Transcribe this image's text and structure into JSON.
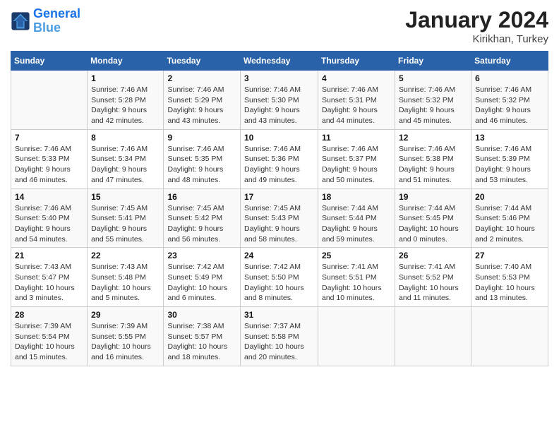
{
  "header": {
    "logo_line1": "General",
    "logo_line2": "Blue",
    "month": "January 2024",
    "location": "Kirikhan, Turkey"
  },
  "weekdays": [
    "Sunday",
    "Monday",
    "Tuesday",
    "Wednesday",
    "Thursday",
    "Friday",
    "Saturday"
  ],
  "weeks": [
    [
      {
        "day": "",
        "sunrise": "",
        "sunset": "",
        "daylight": ""
      },
      {
        "day": "1",
        "sunrise": "Sunrise: 7:46 AM",
        "sunset": "Sunset: 5:28 PM",
        "daylight": "Daylight: 9 hours and 42 minutes."
      },
      {
        "day": "2",
        "sunrise": "Sunrise: 7:46 AM",
        "sunset": "Sunset: 5:29 PM",
        "daylight": "Daylight: 9 hours and 43 minutes."
      },
      {
        "day": "3",
        "sunrise": "Sunrise: 7:46 AM",
        "sunset": "Sunset: 5:30 PM",
        "daylight": "Daylight: 9 hours and 43 minutes."
      },
      {
        "day": "4",
        "sunrise": "Sunrise: 7:46 AM",
        "sunset": "Sunset: 5:31 PM",
        "daylight": "Daylight: 9 hours and 44 minutes."
      },
      {
        "day": "5",
        "sunrise": "Sunrise: 7:46 AM",
        "sunset": "Sunset: 5:32 PM",
        "daylight": "Daylight: 9 hours and 45 minutes."
      },
      {
        "day": "6",
        "sunrise": "Sunrise: 7:46 AM",
        "sunset": "Sunset: 5:32 PM",
        "daylight": "Daylight: 9 hours and 46 minutes."
      }
    ],
    [
      {
        "day": "7",
        "sunrise": "Sunrise: 7:46 AM",
        "sunset": "Sunset: 5:33 PM",
        "daylight": "Daylight: 9 hours and 46 minutes."
      },
      {
        "day": "8",
        "sunrise": "Sunrise: 7:46 AM",
        "sunset": "Sunset: 5:34 PM",
        "daylight": "Daylight: 9 hours and 47 minutes."
      },
      {
        "day": "9",
        "sunrise": "Sunrise: 7:46 AM",
        "sunset": "Sunset: 5:35 PM",
        "daylight": "Daylight: 9 hours and 48 minutes."
      },
      {
        "day": "10",
        "sunrise": "Sunrise: 7:46 AM",
        "sunset": "Sunset: 5:36 PM",
        "daylight": "Daylight: 9 hours and 49 minutes."
      },
      {
        "day": "11",
        "sunrise": "Sunrise: 7:46 AM",
        "sunset": "Sunset: 5:37 PM",
        "daylight": "Daylight: 9 hours and 50 minutes."
      },
      {
        "day": "12",
        "sunrise": "Sunrise: 7:46 AM",
        "sunset": "Sunset: 5:38 PM",
        "daylight": "Daylight: 9 hours and 51 minutes."
      },
      {
        "day": "13",
        "sunrise": "Sunrise: 7:46 AM",
        "sunset": "Sunset: 5:39 PM",
        "daylight": "Daylight: 9 hours and 53 minutes."
      }
    ],
    [
      {
        "day": "14",
        "sunrise": "Sunrise: 7:46 AM",
        "sunset": "Sunset: 5:40 PM",
        "daylight": "Daylight: 9 hours and 54 minutes."
      },
      {
        "day": "15",
        "sunrise": "Sunrise: 7:45 AM",
        "sunset": "Sunset: 5:41 PM",
        "daylight": "Daylight: 9 hours and 55 minutes."
      },
      {
        "day": "16",
        "sunrise": "Sunrise: 7:45 AM",
        "sunset": "Sunset: 5:42 PM",
        "daylight": "Daylight: 9 hours and 56 minutes."
      },
      {
        "day": "17",
        "sunrise": "Sunrise: 7:45 AM",
        "sunset": "Sunset: 5:43 PM",
        "daylight": "Daylight: 9 hours and 58 minutes."
      },
      {
        "day": "18",
        "sunrise": "Sunrise: 7:44 AM",
        "sunset": "Sunset: 5:44 PM",
        "daylight": "Daylight: 9 hours and 59 minutes."
      },
      {
        "day": "19",
        "sunrise": "Sunrise: 7:44 AM",
        "sunset": "Sunset: 5:45 PM",
        "daylight": "Daylight: 10 hours and 0 minutes."
      },
      {
        "day": "20",
        "sunrise": "Sunrise: 7:44 AM",
        "sunset": "Sunset: 5:46 PM",
        "daylight": "Daylight: 10 hours and 2 minutes."
      }
    ],
    [
      {
        "day": "21",
        "sunrise": "Sunrise: 7:43 AM",
        "sunset": "Sunset: 5:47 PM",
        "daylight": "Daylight: 10 hours and 3 minutes."
      },
      {
        "day": "22",
        "sunrise": "Sunrise: 7:43 AM",
        "sunset": "Sunset: 5:48 PM",
        "daylight": "Daylight: 10 hours and 5 minutes."
      },
      {
        "day": "23",
        "sunrise": "Sunrise: 7:42 AM",
        "sunset": "Sunset: 5:49 PM",
        "daylight": "Daylight: 10 hours and 6 minutes."
      },
      {
        "day": "24",
        "sunrise": "Sunrise: 7:42 AM",
        "sunset": "Sunset: 5:50 PM",
        "daylight": "Daylight: 10 hours and 8 minutes."
      },
      {
        "day": "25",
        "sunrise": "Sunrise: 7:41 AM",
        "sunset": "Sunset: 5:51 PM",
        "daylight": "Daylight: 10 hours and 10 minutes."
      },
      {
        "day": "26",
        "sunrise": "Sunrise: 7:41 AM",
        "sunset": "Sunset: 5:52 PM",
        "daylight": "Daylight: 10 hours and 11 minutes."
      },
      {
        "day": "27",
        "sunrise": "Sunrise: 7:40 AM",
        "sunset": "Sunset: 5:53 PM",
        "daylight": "Daylight: 10 hours and 13 minutes."
      }
    ],
    [
      {
        "day": "28",
        "sunrise": "Sunrise: 7:39 AM",
        "sunset": "Sunset: 5:54 PM",
        "daylight": "Daylight: 10 hours and 15 minutes."
      },
      {
        "day": "29",
        "sunrise": "Sunrise: 7:39 AM",
        "sunset": "Sunset: 5:55 PM",
        "daylight": "Daylight: 10 hours and 16 minutes."
      },
      {
        "day": "30",
        "sunrise": "Sunrise: 7:38 AM",
        "sunset": "Sunset: 5:57 PM",
        "daylight": "Daylight: 10 hours and 18 minutes."
      },
      {
        "day": "31",
        "sunrise": "Sunrise: 7:37 AM",
        "sunset": "Sunset: 5:58 PM",
        "daylight": "Daylight: 10 hours and 20 minutes."
      },
      {
        "day": "",
        "sunrise": "",
        "sunset": "",
        "daylight": ""
      },
      {
        "day": "",
        "sunrise": "",
        "sunset": "",
        "daylight": ""
      },
      {
        "day": "",
        "sunrise": "",
        "sunset": "",
        "daylight": ""
      }
    ]
  ]
}
